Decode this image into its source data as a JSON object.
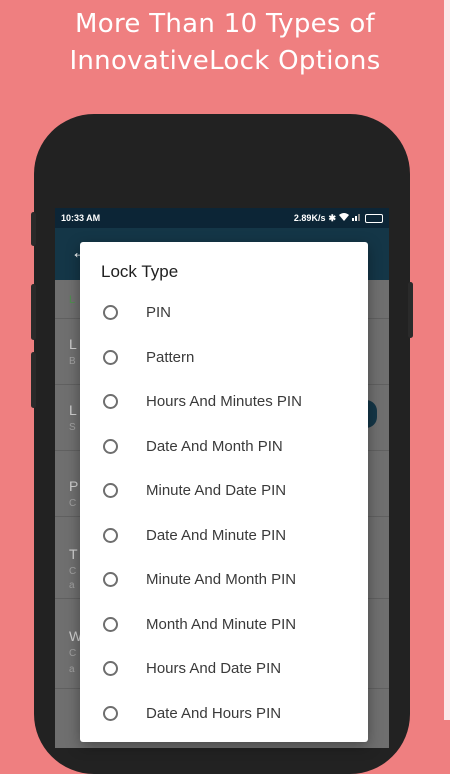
{
  "headline": {
    "line1": "More Than 10 Types of",
    "line2": "InnovativeLock Options"
  },
  "status_bar": {
    "time": "10:33 AM",
    "speed": "2.89K/s",
    "icons": [
      "bluetooth-icon",
      "wifi-icon",
      "signal-icon",
      "battery-icon"
    ]
  },
  "background_list": {
    "section_letter": "L",
    "rows": [
      {
        "letter": "L",
        "sub": "B"
      },
      {
        "letter": "L",
        "sub": "S"
      },
      {
        "letter": "P",
        "sub": "C"
      },
      {
        "letter": "T",
        "sub": "C"
      },
      {
        "letter": "W",
        "sub": "C"
      }
    ],
    "wrap_letters": [
      "a",
      "a"
    ]
  },
  "dialog": {
    "title": "Lock Type",
    "options": [
      {
        "label": "PIN",
        "selected": false
      },
      {
        "label": "Pattern",
        "selected": false
      },
      {
        "label": "Hours And Minutes PIN",
        "selected": false
      },
      {
        "label": "Date And Month PIN",
        "selected": false
      },
      {
        "label": "Minute And Date PIN",
        "selected": false
      },
      {
        "label": "Date And Minute PIN",
        "selected": false
      },
      {
        "label": "Minute And Month PIN",
        "selected": false
      },
      {
        "label": "Month And Minute PIN",
        "selected": false
      },
      {
        "label": "Hours And Date PIN",
        "selected": false
      },
      {
        "label": "Date And Hours PIN",
        "selected": false
      }
    ]
  },
  "colors": {
    "background": "#ef7f80",
    "app_bar": "#143647",
    "status_bar": "#0c2536"
  }
}
